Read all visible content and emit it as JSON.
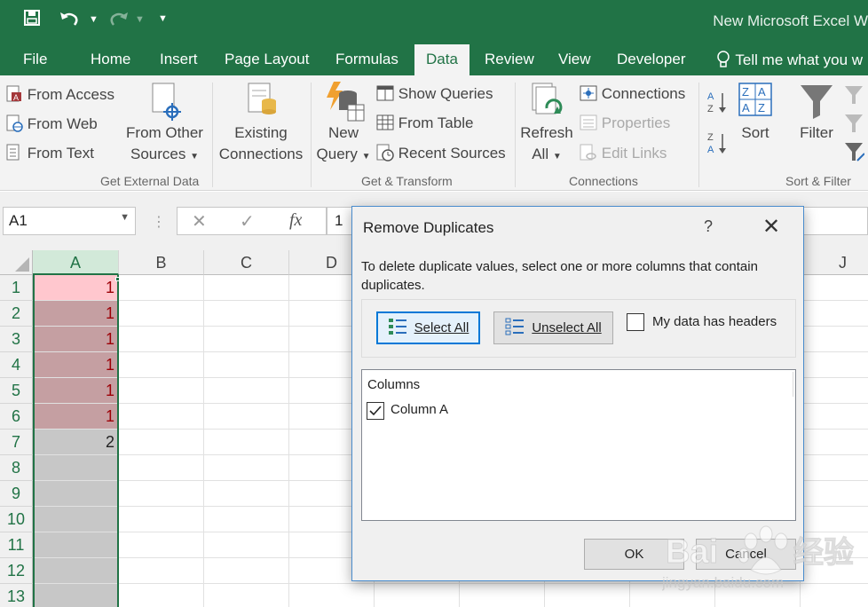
{
  "window": {
    "title": "New Microsoft Excel W"
  },
  "quick_access": {
    "save_icon": "save-icon",
    "undo_icon": "undo-icon",
    "redo_icon": "redo-icon",
    "customize_icon": "customize-icon"
  },
  "tabs": [
    {
      "label": "File"
    },
    {
      "label": "Home"
    },
    {
      "label": "Insert"
    },
    {
      "label": "Page Layout"
    },
    {
      "label": "Formulas"
    },
    {
      "label": "Data"
    },
    {
      "label": "Review"
    },
    {
      "label": "View"
    },
    {
      "label": "Developer"
    }
  ],
  "active_tab": "Data",
  "tell_me": "Tell me what you w",
  "ribbon": {
    "get_external": {
      "from_access": "From Access",
      "from_web": "From Web",
      "from_text": "From Text",
      "from_other_line1": "From Other",
      "from_other_line2": "Sources",
      "existing_line1": "Existing",
      "existing_line2": "Connections",
      "group_label": "Get External Data"
    },
    "get_transform": {
      "new_query_line1": "New",
      "new_query_line2": "Query",
      "show_queries": "Show Queries",
      "from_table": "From Table",
      "recent_sources": "Recent Sources",
      "group_label": "Get & Transform"
    },
    "connections": {
      "refresh_line1": "Refresh",
      "refresh_line2": "All",
      "connections": "Connections",
      "properties": "Properties",
      "edit_links": "Edit Links",
      "group_label": "Connections"
    },
    "sort_filter": {
      "sort": "Sort",
      "filter": "Filter",
      "group_label": "Sort & Filter"
    }
  },
  "formula_bar": {
    "name_box": "A1",
    "fx": "fx",
    "value": "1"
  },
  "sheet": {
    "columns": [
      "A",
      "B",
      "C",
      "D",
      "J"
    ],
    "rows": [
      "1",
      "2",
      "3",
      "4",
      "5",
      "6",
      "7",
      "8",
      "9",
      "10",
      "11",
      "12",
      "13"
    ],
    "col_a_values": [
      "1",
      "1",
      "1",
      "1",
      "1",
      "1",
      "2",
      "",
      "",
      "",
      "",
      "",
      ""
    ]
  },
  "dialog": {
    "title": "Remove Duplicates",
    "help": "?",
    "close": "✕",
    "description": "To delete duplicate values, select one or more columns that contain duplicates.",
    "select_all": "Select All",
    "unselect_all": "Unselect All",
    "headers_label": "My data has headers",
    "headers_checked": false,
    "columns_header": "Columns",
    "column_items": [
      {
        "label": "Column A",
        "checked": true
      }
    ],
    "ok": "OK",
    "cancel": "Cancel"
  },
  "watermark": {
    "text": "Bai 经验",
    "url": "jingyan.baidu.com"
  },
  "colors": {
    "excel_green": "#217346",
    "duplicate_fill": "#ffc7ce",
    "duplicate_text": "#9c0006",
    "dialog_border": "#4a8ccd"
  }
}
